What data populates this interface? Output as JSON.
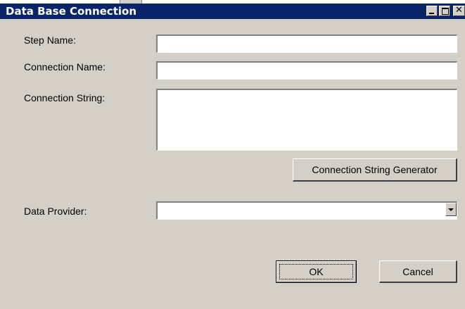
{
  "window": {
    "title": "Data Base Connection"
  },
  "form": {
    "step_name_label": "Step Name:",
    "step_name_value": "",
    "connection_name_label": "Connection Name:",
    "connection_name_value": "",
    "connection_string_label": "Connection String:",
    "connection_string_value": "",
    "generator_button_label": "Connection String Generator",
    "data_provider_label": "Data Provider:",
    "data_provider_value": ""
  },
  "buttons": {
    "ok_label": "OK",
    "cancel_label": "Cancel"
  },
  "icons": {
    "minimize": "minimize-icon",
    "maximize": "maximize-icon",
    "close": "close-icon",
    "dropdown": "chevron-down-icon"
  },
  "colors": {
    "titlebar": "#0a246a",
    "dialog_bg": "#d4d0c8"
  }
}
